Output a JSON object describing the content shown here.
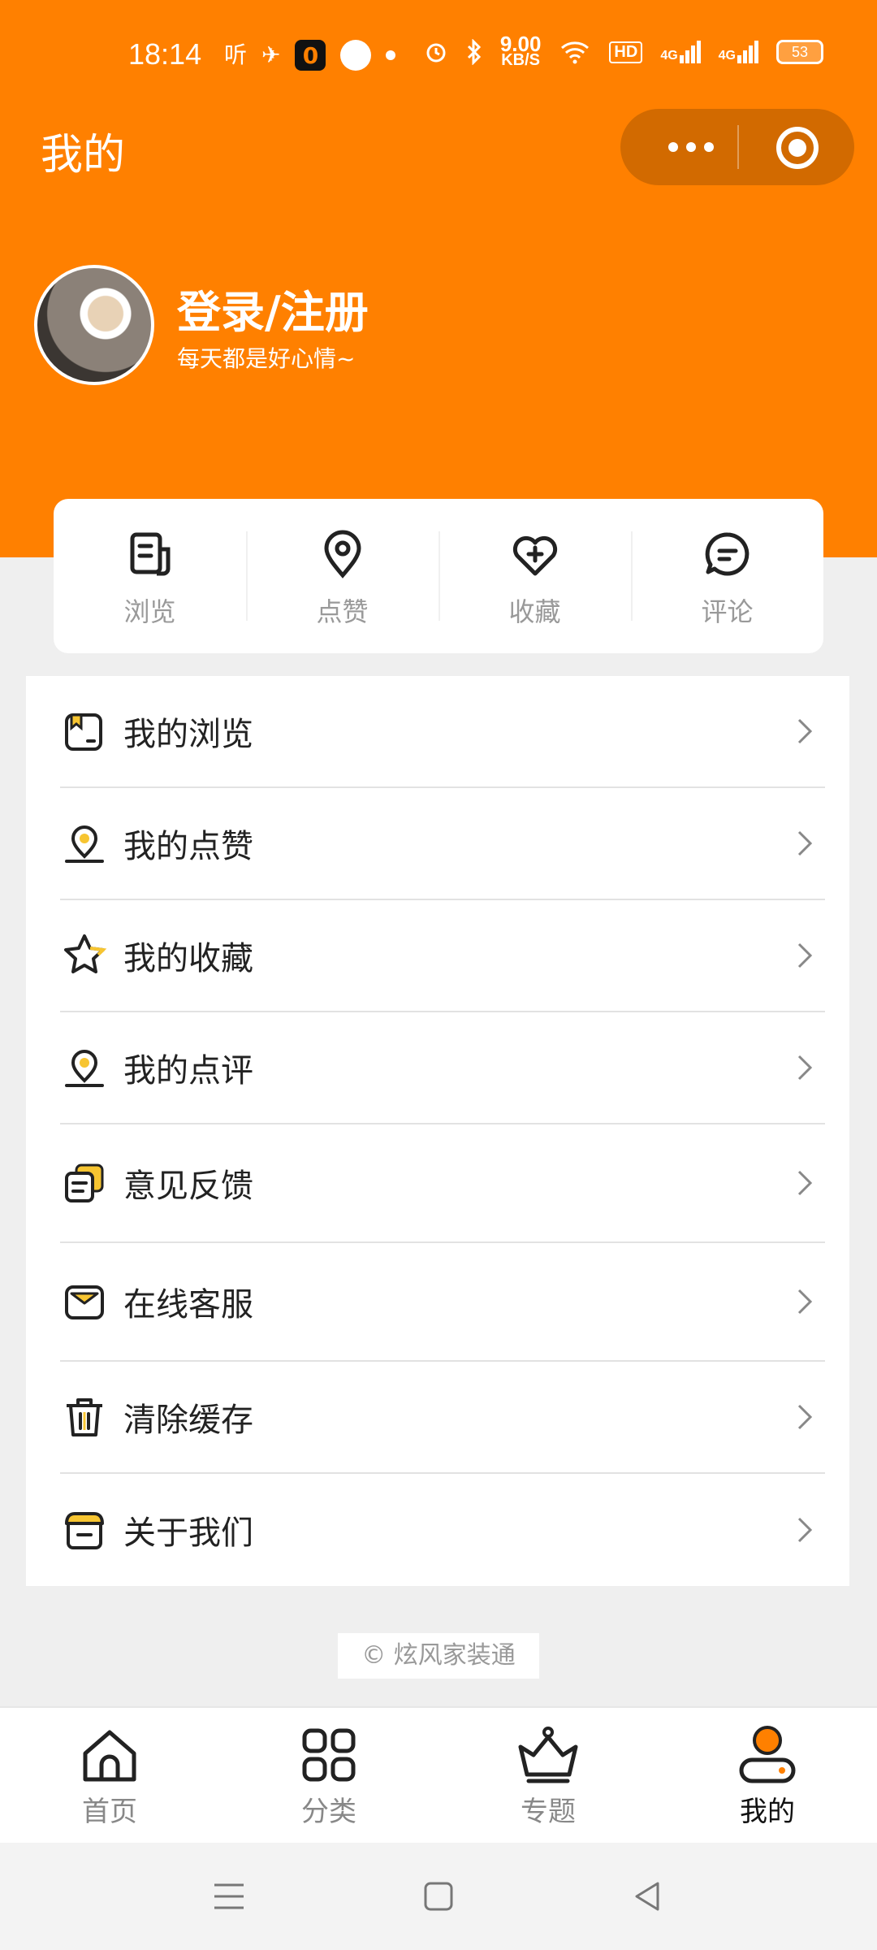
{
  "status_bar": {
    "time": "18:14",
    "ting": "听",
    "speed_value": "9.00",
    "speed_unit": "KB/S",
    "hd": "HD",
    "network_1": "4G",
    "network_2": "4G",
    "battery": "53"
  },
  "header": {
    "title": "我的",
    "login_title": "登录/注册",
    "login_subtitle": "每天都是好心情~",
    "accent_color": "#ff8000"
  },
  "quick_actions": [
    {
      "label": "浏览",
      "icon": "document-icon"
    },
    {
      "label": "点赞",
      "icon": "location-pin-icon"
    },
    {
      "label": "收藏",
      "icon": "heart-plus-icon"
    },
    {
      "label": "评论",
      "icon": "comment-icon"
    }
  ],
  "menu": [
    {
      "label": "我的浏览",
      "icon": "browse-history-icon"
    },
    {
      "label": "我的点赞",
      "icon": "pin-like-icon"
    },
    {
      "label": "我的收藏",
      "icon": "star-icon"
    },
    {
      "label": "我的点评",
      "icon": "pin-review-icon"
    },
    {
      "label": "意见反馈",
      "icon": "feedback-icon"
    },
    {
      "label": "在线客服",
      "icon": "envelope-icon"
    },
    {
      "label": "清除缓存",
      "icon": "trash-icon"
    },
    {
      "label": "关于我们",
      "icon": "store-icon"
    }
  ],
  "footer": {
    "copyright": "© 炫风家装通"
  },
  "tabbar": [
    {
      "label": "首页",
      "icon": "home-icon",
      "active": false
    },
    {
      "label": "分类",
      "icon": "grid-icon",
      "active": false
    },
    {
      "label": "专题",
      "icon": "crown-icon",
      "active": false
    },
    {
      "label": "我的",
      "icon": "profile-icon",
      "active": true
    }
  ]
}
